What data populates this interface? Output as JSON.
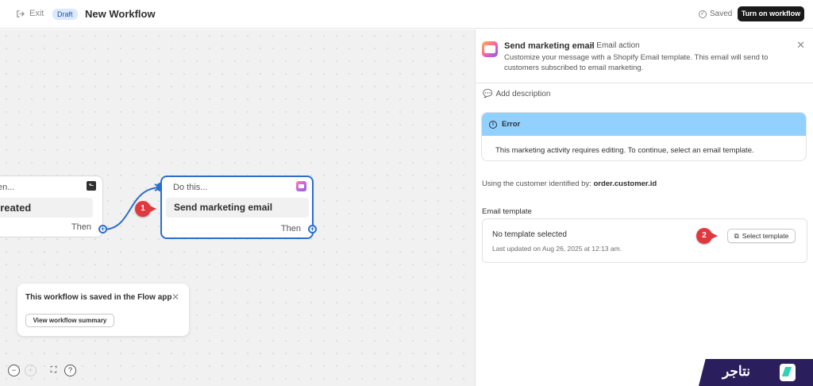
{
  "topbar": {
    "exit_label": "Exit",
    "status_badge": "Draft",
    "title": "New Workflow",
    "saved_label": "Saved",
    "turn_on_label": "Turn on workflow"
  },
  "canvas": {
    "trigger_node": {
      "header": "en...",
      "body": "created",
      "then": "Then"
    },
    "action_node": {
      "header": "Do this...",
      "body": "Send marketing email",
      "then": "Then"
    },
    "callouts": [
      "1",
      "2"
    ],
    "toast": {
      "message": "This workflow is saved in the Flow app",
      "button": "View workflow summary"
    },
    "zoom_controls": {
      "out": "−",
      "in": "+",
      "fit": "⛶",
      "help": "?"
    }
  },
  "panel": {
    "title": "Send marketing email",
    "type": "• Email action",
    "description": "Customize your message with a Shopify Email template. This email will send to customers subscribed to email marketing.",
    "add_description": "Add description",
    "error": {
      "heading": "Error",
      "text": "This marketing activity requires editing. To continue, select an email template."
    },
    "customer_prefix": "Using the customer identified by:",
    "customer_id": "order.customer.id",
    "template_label": "Email template",
    "template": {
      "none": "No template selected",
      "updated": "Last updated on Aug 26, 2025 at 12:13 am.",
      "button": "Select template"
    }
  },
  "watermark": {
    "text": "نتاجر"
  },
  "colors": {
    "accent": "#2c6ecb",
    "callout": "#e0383e",
    "error_banner": "#91d0ff",
    "primary_button": "#1a1a1a"
  }
}
